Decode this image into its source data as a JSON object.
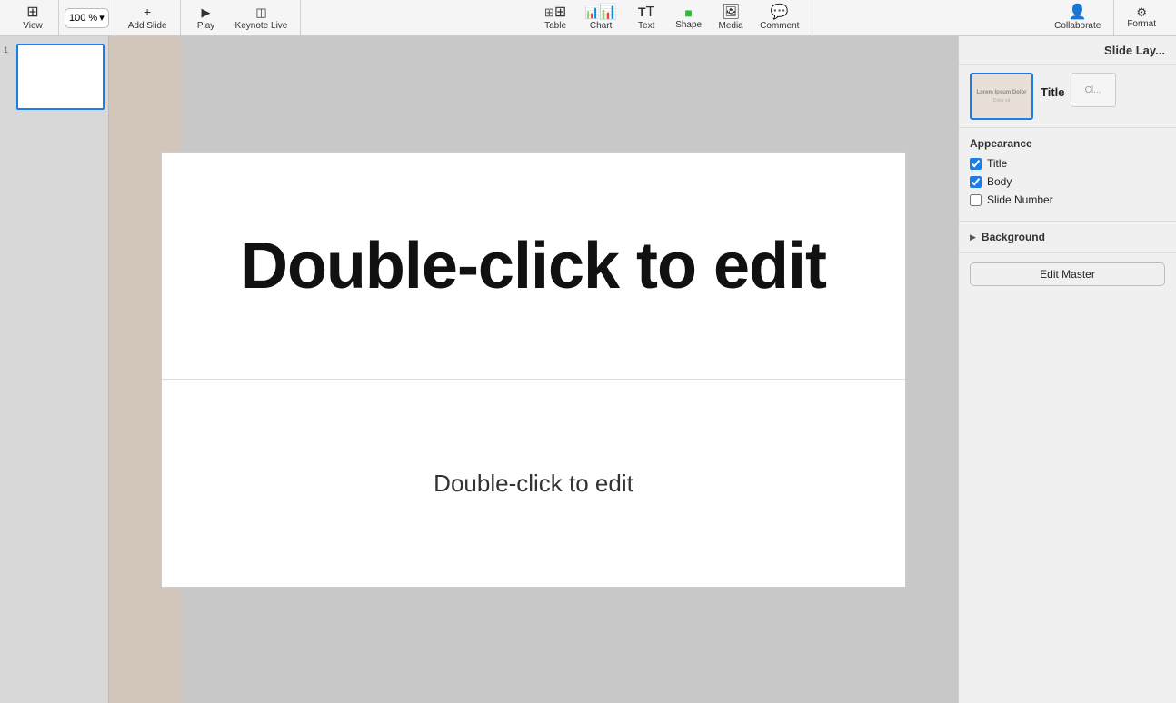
{
  "toolbar": {
    "view_label": "View",
    "zoom_value": "100 %",
    "add_slide_label": "Add Slide",
    "play_label": "Play",
    "keynote_live_label": "Keynote Live",
    "table_label": "Table",
    "chart_label": "Chart",
    "text_label": "Text",
    "shape_label": "Shape",
    "media_label": "Media",
    "comment_label": "Comment",
    "collaborate_label": "Collaborate",
    "format_label": "Format"
  },
  "slide_panel": {
    "slide_number": "1"
  },
  "canvas": {
    "title_placeholder": "Double-click to edit",
    "body_placeholder": "Double-click to edit"
  },
  "format_panel": {
    "header_label": "Slide Lay...",
    "layout_name": "Title",
    "layout_thumb_line1": "Lorem Ipsum Dolor",
    "layout_thumb_line2": "Dolor sit",
    "second_layout_label": "Cl...",
    "appearance_label": "Appearance",
    "title_checkbox_label": "Title",
    "body_checkbox_label": "Body",
    "slide_number_checkbox_label": "Slide Number",
    "background_label": "Background",
    "edit_master_label": "Edit Master"
  }
}
